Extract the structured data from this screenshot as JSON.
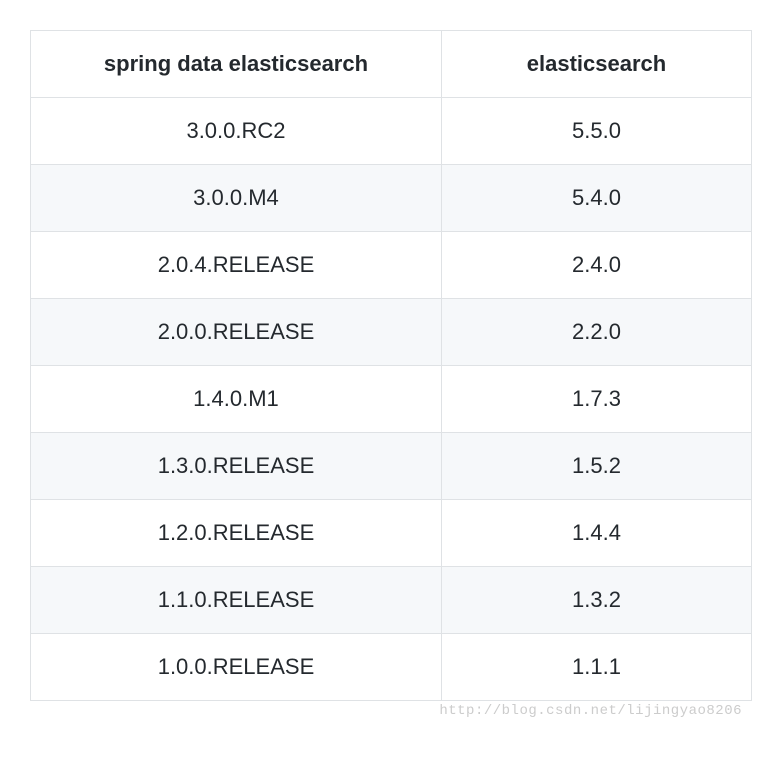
{
  "table": {
    "headers": [
      "spring data elasticsearch",
      "elasticsearch"
    ],
    "rows": [
      {
        "sde": "3.0.0.RC2",
        "es": "5.5.0"
      },
      {
        "sde": "3.0.0.M4",
        "es": "5.4.0"
      },
      {
        "sde": "2.0.4.RELEASE",
        "es": "2.4.0"
      },
      {
        "sde": "2.0.0.RELEASE",
        "es": "2.2.0"
      },
      {
        "sde": "1.4.0.M1",
        "es": "1.7.3"
      },
      {
        "sde": "1.3.0.RELEASE",
        "es": "1.5.2"
      },
      {
        "sde": "1.2.0.RELEASE",
        "es": "1.4.4"
      },
      {
        "sde": "1.1.0.RELEASE",
        "es": "1.3.2"
      },
      {
        "sde": "1.0.0.RELEASE",
        "es": "1.1.1"
      }
    ]
  },
  "watermark": "http://blog.csdn.net/lijingyao8206"
}
